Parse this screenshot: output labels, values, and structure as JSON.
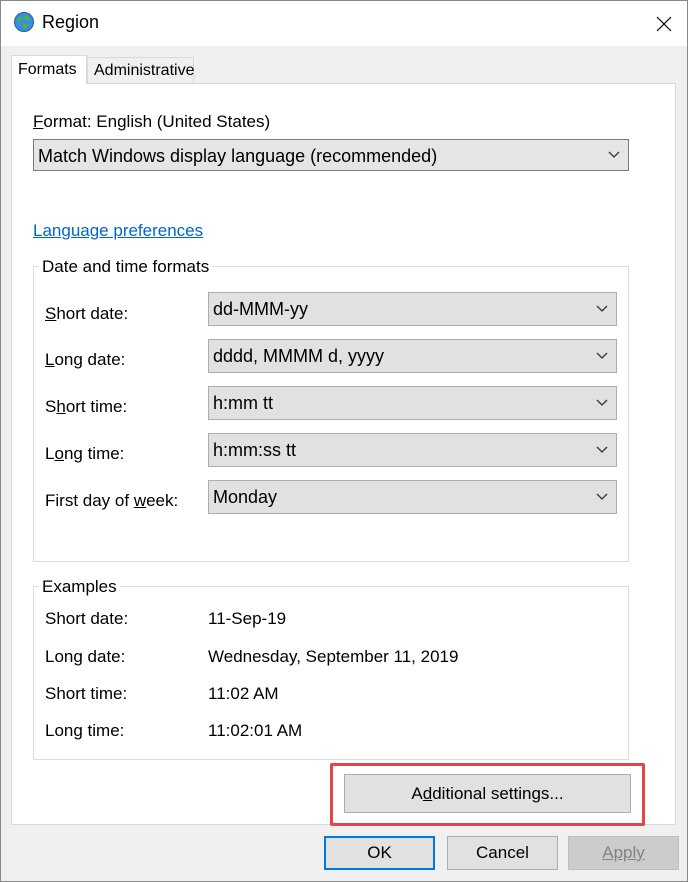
{
  "window": {
    "title": "Region"
  },
  "tabs": [
    {
      "label": "Formats",
      "active": true
    },
    {
      "label": "Administrative",
      "active": false
    }
  ],
  "format": {
    "label_prefix": "F",
    "label_rest": "ormat: English (United States)",
    "selected": "Match Windows display language (recommended)"
  },
  "language_link": "Language preferences",
  "date_time_formats": {
    "title": "Date and time formats",
    "rows": [
      {
        "pre": "",
        "ul": "S",
        "post": "hort date:",
        "value": "dd-MMM-yy"
      },
      {
        "pre": "",
        "ul": "L",
        "post": "ong date:",
        "value": "dddd, MMMM d, yyyy"
      },
      {
        "pre": "S",
        "ul": "h",
        "post": "ort time:",
        "value": "h:mm tt"
      },
      {
        "pre": "L",
        "ul": "o",
        "post": "ng time:",
        "value": "h:mm:ss tt"
      },
      {
        "pre": "First day of ",
        "ul": "w",
        "post": "eek:",
        "value": "Monday"
      }
    ]
  },
  "examples": {
    "title": "Examples",
    "rows": [
      {
        "label": "Short date:",
        "value": "11-Sep-19"
      },
      {
        "label": "Long date:",
        "value": "Wednesday, September 11, 2019"
      },
      {
        "label": "Short time:",
        "value": "11:02 AM"
      },
      {
        "label": "Long time:",
        "value": "11:02:01 AM"
      }
    ]
  },
  "buttons": {
    "additional_pre": "A",
    "additional_ul": "d",
    "additional_post": "ditional settings...",
    "ok": "OK",
    "cancel": "Cancel",
    "apply": "Apply"
  },
  "colors": {
    "accent": "#0078d7",
    "link": "#0066cc",
    "highlight": "#e0474c"
  }
}
